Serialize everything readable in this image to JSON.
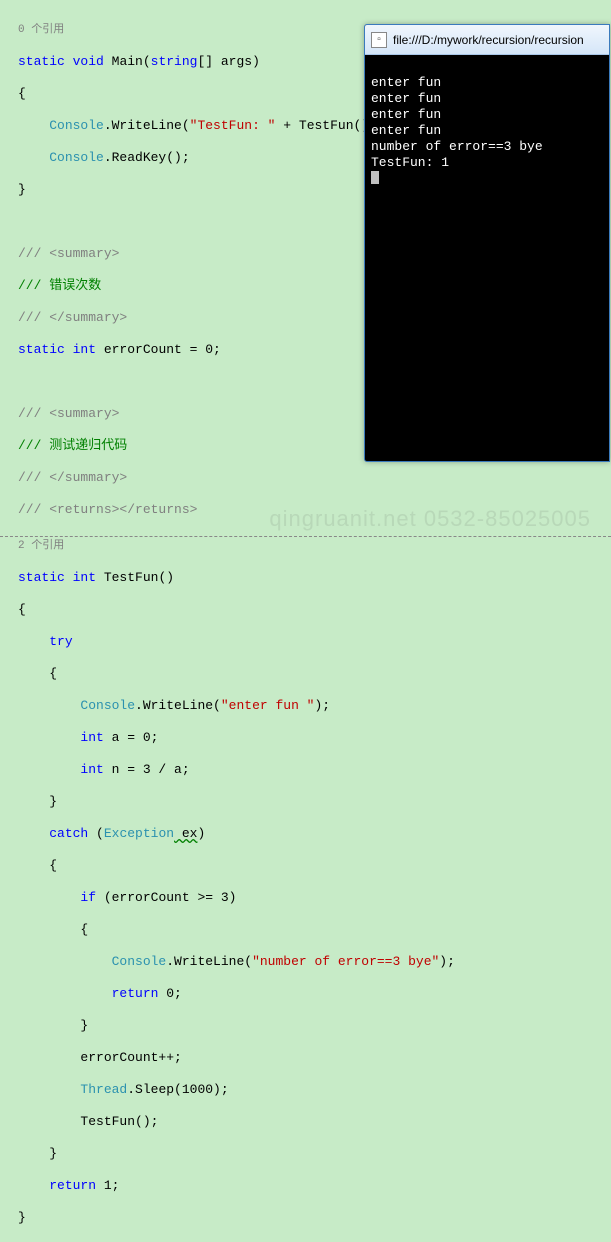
{
  "editor": {
    "ref0": "0 个引用",
    "l1_static": "static",
    "l1_void": "void",
    "l1_main": " Main(",
    "l1_string": "string",
    "l1_rest": "[] args)",
    "brace_open": "{",
    "brace_close": "}",
    "console": "Console",
    "writeline": ".WriteLine(",
    "str_testfun": "\"TestFun: \"",
    "plus_testfun": " + TestFun());",
    "readkey": ".ReadKey();",
    "sum_open": "/// <summary>",
    "sum_err": "/// 错误次数",
    "sum_close": "/// </summary>",
    "int_kw": "int",
    "err_decl": " errorCount = 0;",
    "sum_test": "/// 测试递归代码",
    "returns": "/// <returns></returns>",
    "ref2": "2 个引用",
    "testfun_name": " TestFun()",
    "try_kw": "try",
    "str_enter": "\"enter fun \"",
    "close_paren": ");",
    "a_decl": " a = 0;",
    "n_decl": " n = 3 / a;",
    "catch_kw": "catch",
    "exception": "Exception",
    "ex_var": " ex",
    "if_kw": "if",
    "if_cond": " (errorCount >= 3)",
    "str_bye": "\"number of error==3 bye\"",
    "return_kw": "return",
    "ret0": " 0;",
    "err_inc": "errorCount++;",
    "thread": "Thread",
    "sleep": ".Sleep(1000);",
    "testfun_call": "TestFun();",
    "ret1": " 1;"
  },
  "console": {
    "title": "file:///D:/mywork/recursion/recursion",
    "out1": "enter fun",
    "out2": "enter fun",
    "out3": "enter fun",
    "out4": "enter fun",
    "out5": "number of error==3 bye",
    "out6": "TestFun: 1"
  },
  "watermark": "qingruanit.net 0532-85025005"
}
